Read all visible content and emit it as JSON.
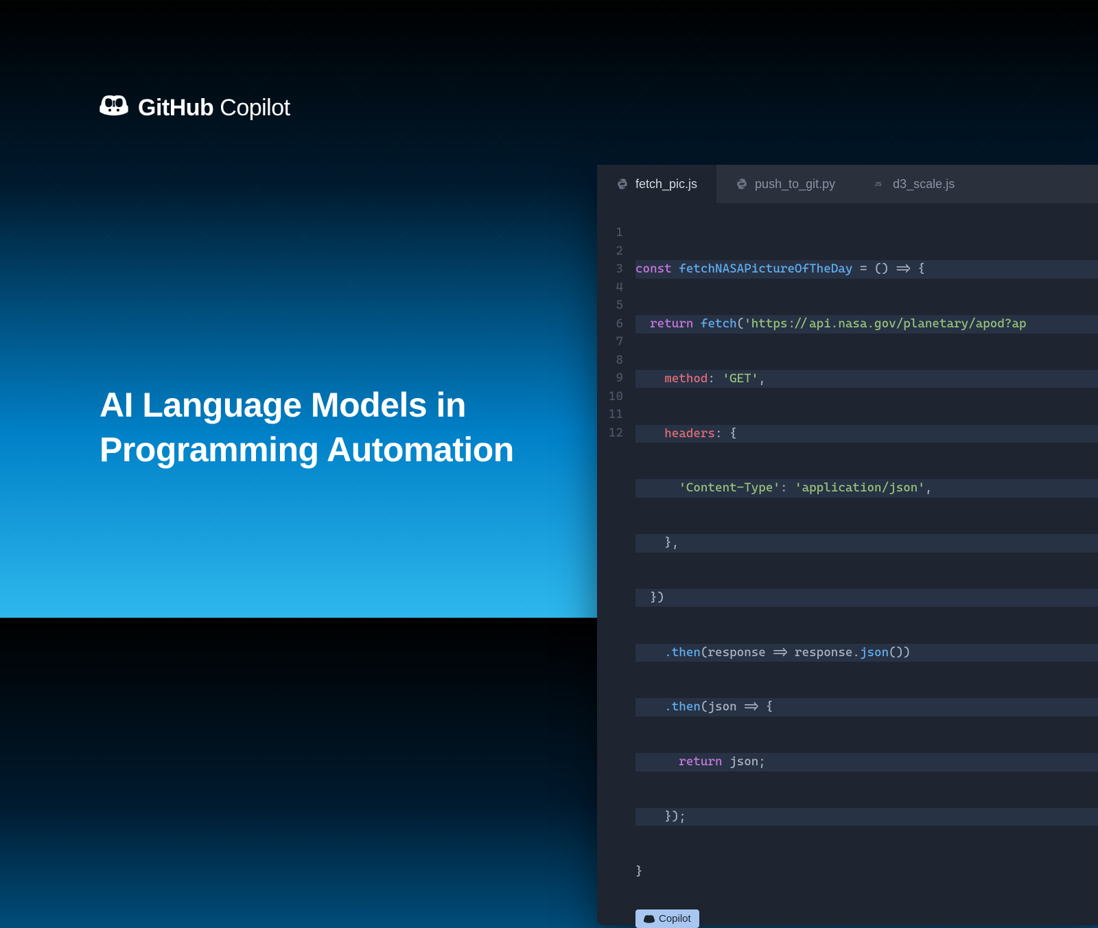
{
  "logo": {
    "github": "GitHub",
    "copilot": " Copilot"
  },
  "headline_line1": "AI Language Models in",
  "headline_line2": "Programming Automation",
  "tabs": [
    {
      "label": "fetch_pic.js",
      "icon": "python-icon",
      "active": true
    },
    {
      "label": "push_to_git.py",
      "icon": "python-icon",
      "active": false
    },
    {
      "label": "d3_scale.js",
      "icon": "js-icon",
      "active": false
    }
  ],
  "line_numbers": [
    "1",
    "2",
    "3",
    "4",
    "5",
    "6",
    "7",
    "8",
    "9",
    "10",
    "11",
    "12"
  ],
  "code": {
    "l1_const": "const ",
    "l1_fn": "fetchNASAPictureOfTheDay",
    "l1_rest": " = () => {",
    "l2_return": "  return ",
    "l2_fetch": "fetch",
    "l2_paren": "(",
    "l2_url": "'https://api.nasa.gov/planetary/apod?ap",
    "l3_method_key": "    method",
    "l3_method_val": "'GET'",
    "l3_colon": ": ",
    "l3_comma": ",",
    "l4_headers_key": "    headers",
    "l4_headers_rest": ": {",
    "l5_ct_key": "      'Content-Type'",
    "l5_ct_val": "'application/json'",
    "l5_colon": ": ",
    "l5_comma": ",",
    "l6": "    },",
    "l7": "  })",
    "l8_indent": "    ",
    "l8_then": ".then",
    "l8_rest1": "(response => response.",
    "l8_json": "json",
    "l8_rest2": "())",
    "l9_indent": "    ",
    "l9_then": ".then",
    "l9_rest": "(json => {",
    "l10_return": "      return ",
    "l10_rest": "json;",
    "l11": "    });",
    "l12": "}"
  },
  "badge_label": "Copilot"
}
